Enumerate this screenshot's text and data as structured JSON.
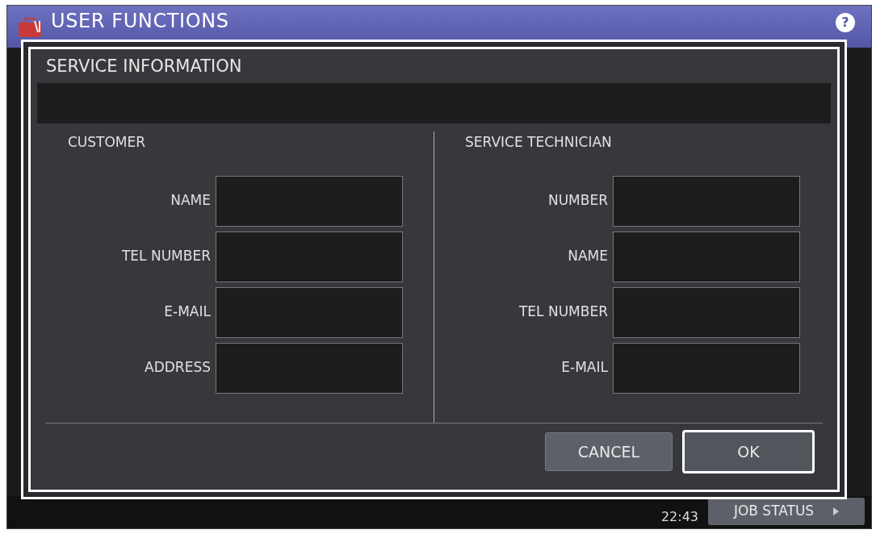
{
  "app": {
    "title": "USER FUNCTIONS",
    "help": "?"
  },
  "dialog": {
    "title": "SERVICE INFORMATION",
    "sections": [
      {
        "heading": "CUSTOMER",
        "fields": [
          {
            "label": "NAME"
          },
          {
            "label": "TEL NUMBER"
          },
          {
            "label": "E-MAIL"
          },
          {
            "label": "ADDRESS"
          }
        ]
      },
      {
        "heading": "SERVICE TECHNICIAN",
        "fields": [
          {
            "label": "NUMBER"
          },
          {
            "label": "NAME"
          },
          {
            "label": "TEL NUMBER"
          },
          {
            "label": "E-MAIL"
          }
        ]
      }
    ],
    "buttons": [
      {
        "label": "CANCEL",
        "kind": "secondary"
      },
      {
        "label": "OK",
        "kind": "primary"
      }
    ]
  },
  "status_bar": {
    "time": "22:43",
    "job_status": "JOB STATUS"
  }
}
